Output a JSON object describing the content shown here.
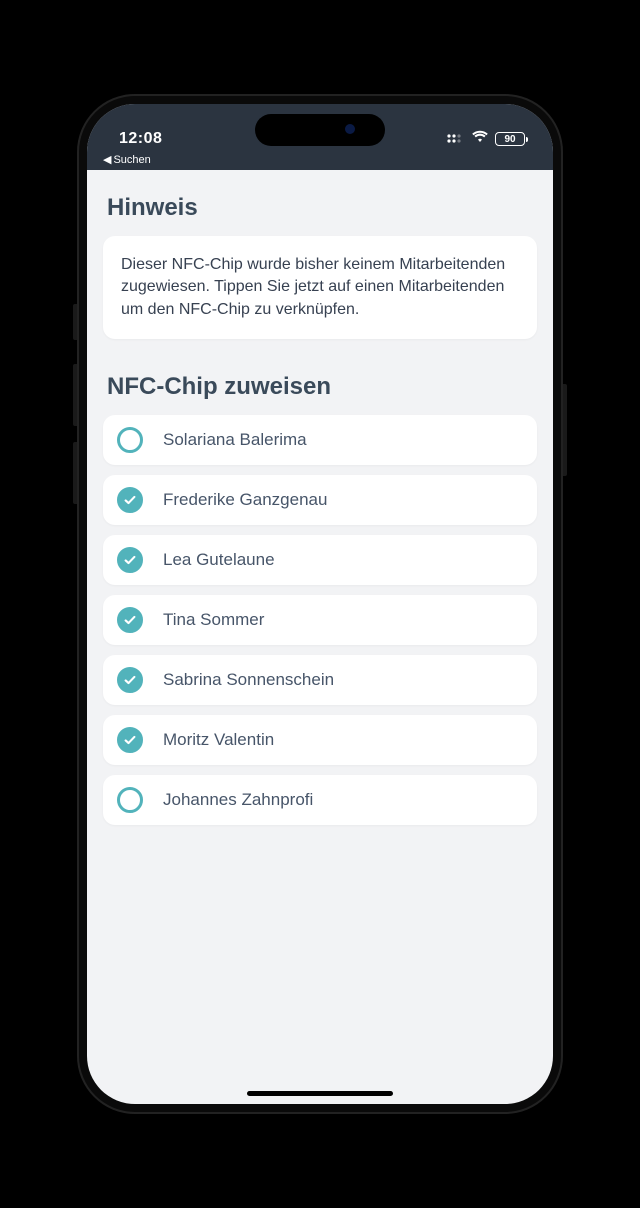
{
  "status": {
    "time": "12:08",
    "back_label": "Suchen",
    "battery": "90"
  },
  "hint": {
    "title": "Hinweis",
    "body": "Dieser NFC-Chip wurde bisher keinem Mitarbeitenden zugewiesen. Tippen Sie jetzt auf einen Mitarbeitenden um den NFC-Chip zu verknüpfen."
  },
  "assign": {
    "title": "NFC-Chip zuweisen",
    "items": [
      {
        "name": "Solariana Balerima",
        "selected": false
      },
      {
        "name": "Frederike Ganzgenau",
        "selected": true
      },
      {
        "name": "Lea Gutelaune",
        "selected": true
      },
      {
        "name": "Tina Sommer",
        "selected": true
      },
      {
        "name": "Sabrina Sonnenschein",
        "selected": true
      },
      {
        "name": "Moritz Valentin",
        "selected": true
      },
      {
        "name": "Johannes Zahnprofi",
        "selected": false
      }
    ]
  }
}
